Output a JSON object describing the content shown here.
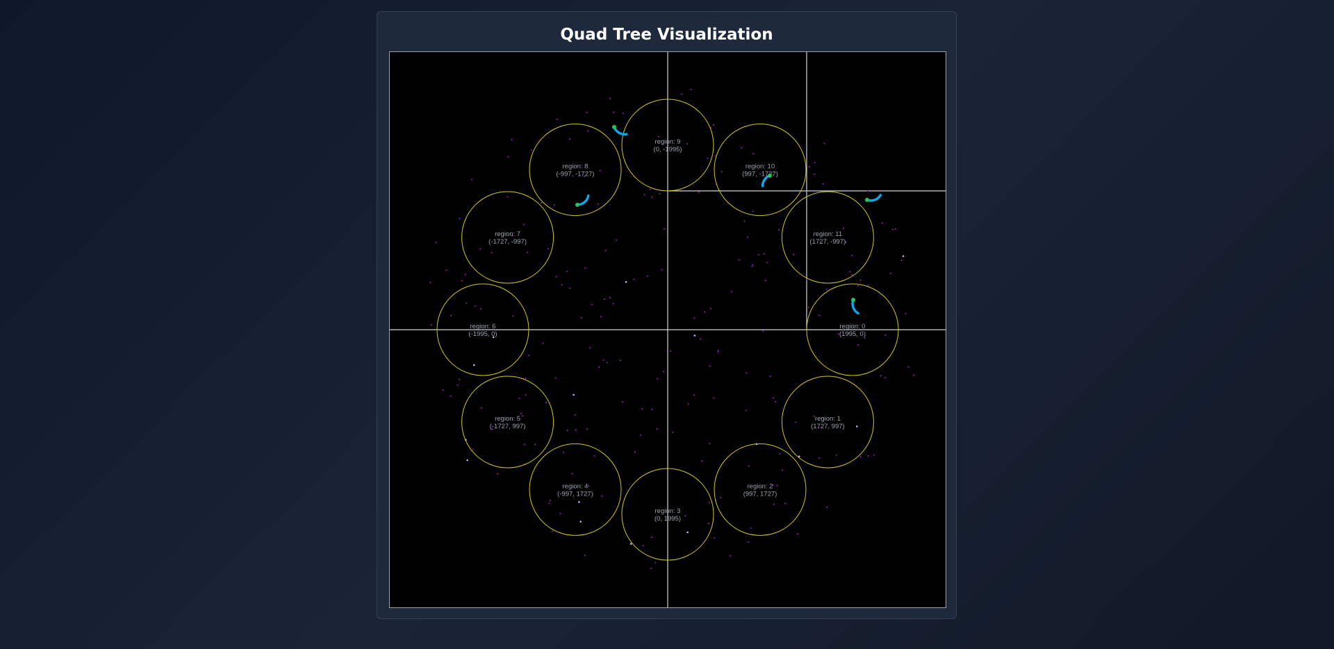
{
  "page": {
    "title": "Quad Tree Visualization"
  },
  "colors": {
    "background": "#000000",
    "quadtree_lines": "#d1d5db",
    "region_circle": "#d6c81a",
    "region_text": "#9ca3af",
    "point": "#a21ccb",
    "agent_body": "#22c55e",
    "agent_arc": "#0ea5e9"
  },
  "regions": [
    {
      "label": "region: 0",
      "coords": "(1995, 0)"
    },
    {
      "label": "region: 1",
      "coords": "(1727, 997)"
    },
    {
      "label": "region: 2",
      "coords": "(997, 1727)"
    },
    {
      "label": "region: 3",
      "coords": "(0, 1995)"
    },
    {
      "label": "region: 4",
      "coords": "(-997, 1727)"
    },
    {
      "label": "region: 5",
      "coords": "(-1727, 997)"
    },
    {
      "label": "region: 6",
      "coords": "(-1995, 0)"
    },
    {
      "label": "region: 7",
      "coords": "(-1727, -997)"
    },
    {
      "label": "region: 8",
      "coords": "(-997, -1727)"
    },
    {
      "label": "region: 9",
      "coords": "(0, -1995)"
    },
    {
      "label": "region: 10",
      "coords": "(997, -1727)"
    },
    {
      "label": "region: 11",
      "coords": "(1727, -997)"
    }
  ]
}
